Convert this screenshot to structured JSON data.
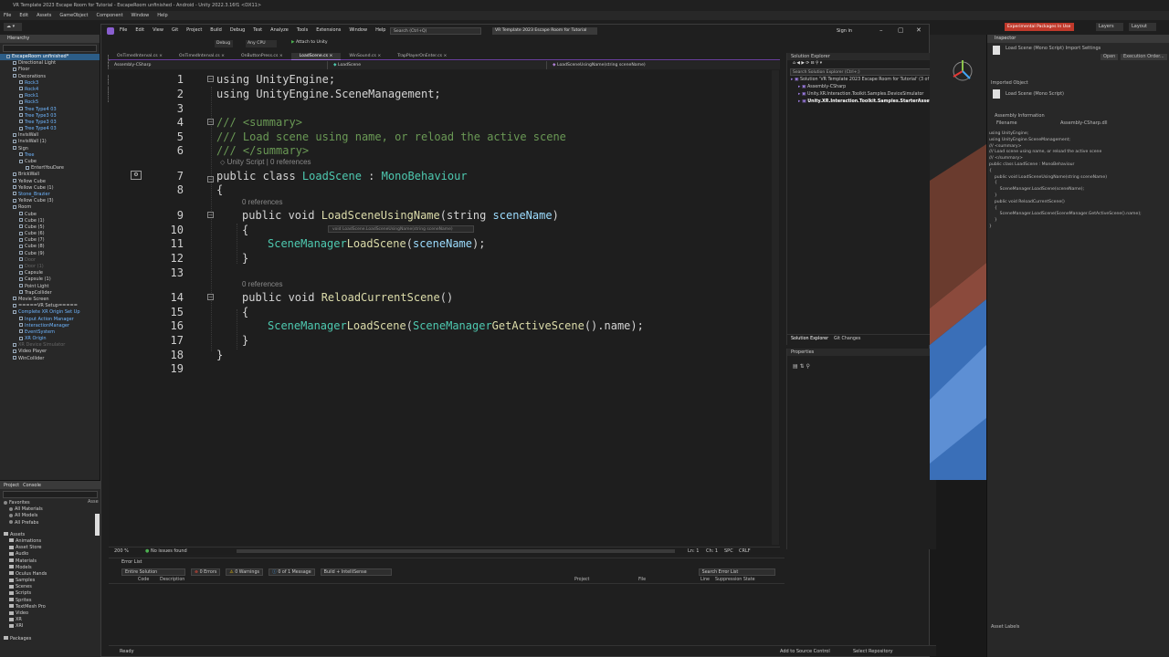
{
  "unity": {
    "window_title": "VR Template 2023 Escape Room for Tutorial - EscapeRoom unfinished - Android - Unity 2022.3.16f1 <DX11>",
    "menu": [
      "File",
      "Edit",
      "Assets",
      "GameObject",
      "Component",
      "Window",
      "Help"
    ],
    "hierarchy": {
      "tab": "Hierarchy",
      "items": [
        {
          "label": "EscapeRoom unfinished*",
          "indent": 1,
          "style": "sel"
        },
        {
          "label": "Directional Light",
          "indent": 2,
          "style": ""
        },
        {
          "label": "Floor",
          "indent": 2,
          "style": ""
        },
        {
          "label": "Decorations",
          "indent": 2,
          "style": ""
        },
        {
          "label": "Rock3",
          "indent": 3,
          "style": "blue"
        },
        {
          "label": "Rock4",
          "indent": 3,
          "style": "blue"
        },
        {
          "label": "Rock1",
          "indent": 3,
          "style": "blue"
        },
        {
          "label": "Rock5",
          "indent": 3,
          "style": "blue"
        },
        {
          "label": "Tree Type4 03",
          "indent": 3,
          "style": "blue"
        },
        {
          "label": "Tree Type3 03",
          "indent": 3,
          "style": "blue"
        },
        {
          "label": "Tree Type3 03",
          "indent": 3,
          "style": "blue"
        },
        {
          "label": "Tree Type4 03",
          "indent": 3,
          "style": "blue"
        },
        {
          "label": "InvisWall",
          "indent": 2,
          "style": ""
        },
        {
          "label": "InvisWall (1)",
          "indent": 2,
          "style": ""
        },
        {
          "label": "Sign",
          "indent": 2,
          "style": ""
        },
        {
          "label": "Tree",
          "indent": 3,
          "style": "blue"
        },
        {
          "label": "Cube",
          "indent": 3,
          "style": ""
        },
        {
          "label": "EntertYouDare",
          "indent": 4,
          "style": ""
        },
        {
          "label": "BrickWall",
          "indent": 2,
          "style": ""
        },
        {
          "label": "Yellow Cube",
          "indent": 2,
          "style": ""
        },
        {
          "label": "Yellow Cube (1)",
          "indent": 2,
          "style": ""
        },
        {
          "label": "Stone_Brazier",
          "indent": 2,
          "style": "blue"
        },
        {
          "label": "Yellow Cube (3)",
          "indent": 2,
          "style": ""
        },
        {
          "label": "Room",
          "indent": 2,
          "style": ""
        },
        {
          "label": "Cube",
          "indent": 3,
          "style": ""
        },
        {
          "label": "Cube (1)",
          "indent": 3,
          "style": ""
        },
        {
          "label": "Cube (5)",
          "indent": 3,
          "style": ""
        },
        {
          "label": "Cube (6)",
          "indent": 3,
          "style": ""
        },
        {
          "label": "Cube (7)",
          "indent": 3,
          "style": ""
        },
        {
          "label": "Cube (8)",
          "indent": 3,
          "style": ""
        },
        {
          "label": "Cube (9)",
          "indent": 3,
          "style": ""
        },
        {
          "label": "Door",
          "indent": 3,
          "style": "dim"
        },
        {
          "label": "Door (1)",
          "indent": 3,
          "style": "dim"
        },
        {
          "label": "Capsule",
          "indent": 3,
          "style": ""
        },
        {
          "label": "Capsule (1)",
          "indent": 3,
          "style": ""
        },
        {
          "label": "Point Light",
          "indent": 3,
          "style": ""
        },
        {
          "label": "TrapCollider",
          "indent": 3,
          "style": ""
        },
        {
          "label": "Movie Screen",
          "indent": 2,
          "style": ""
        },
        {
          "label": "=====VR Setup=====",
          "indent": 2,
          "style": ""
        },
        {
          "label": "Complete XR Origin Set Up",
          "indent": 2,
          "style": "blue"
        },
        {
          "label": "Input Action Manager",
          "indent": 3,
          "style": "blue"
        },
        {
          "label": "InteractionManager",
          "indent": 3,
          "style": "blue"
        },
        {
          "label": "EventSystem",
          "indent": 3,
          "style": "blue"
        },
        {
          "label": "XR Origin",
          "indent": 3,
          "style": "blue"
        },
        {
          "label": "XR Device Simulator",
          "indent": 2,
          "style": "dim"
        },
        {
          "label": "Video Player",
          "indent": 2,
          "style": ""
        },
        {
          "label": "WinCollider",
          "indent": 2,
          "style": ""
        }
      ]
    },
    "project": {
      "tabs": [
        "Project",
        "Console"
      ],
      "favorites_label": "Favorites",
      "favorites": [
        "All Materials",
        "All Models",
        "All Prefabs"
      ],
      "assets_label": "Assets",
      "assets": [
        "Animations",
        "Asset Store",
        "Audio",
        "Materials",
        "Models",
        "Oculus Hands",
        "Samples",
        "Scenes",
        "Scripts",
        "Sprites",
        "TextMesh Pro",
        "Video",
        "XR",
        "XRI"
      ],
      "packages_label": "Packages",
      "side_label": "Asse"
    },
    "inspector": {
      "tab": "Inspector",
      "title": "Load Scene (Mono Script) Import Settings",
      "open_btn": "Open",
      "exec_btn": "Execution Order...",
      "imported_label": "Imported Object",
      "object_name": "Load Scene (Mono Script)",
      "assembly_heading": "Assembly Information",
      "filename_label": "Filename",
      "filename_value": "Assembly-CSharp.dll",
      "preview": [
        "using UnityEngine;",
        "using UnityEngine.SceneManagement;",
        "",
        "/// <summary>",
        "/// Load scene using name, or reload the active scene",
        "/// </summary>",
        "public class LoadScene : MonoBehaviour",
        "{",
        "    public void LoadSceneUsingName(string sceneName)",
        "    {",
        "        SceneManager.LoadScene(sceneName);",
        "    }",
        "",
        "    public void ReloadCurrentScene()",
        "    {",
        "        SceneManager.LoadScene(SceneManager.GetActiveScene().name);",
        "    }",
        "}"
      ],
      "asset_labels": "Asset Labels"
    },
    "top_right": {
      "packages_btn": "Experimental Packages In Use",
      "layers": "Layers",
      "layout": "Layout"
    }
  },
  "vs": {
    "menu": [
      "File",
      "Edit",
      "View",
      "Git",
      "Project",
      "Build",
      "Debug",
      "Test",
      "Analyze",
      "Tools",
      "Extensions",
      "Window",
      "Help"
    ],
    "search": "Search (Ctrl+Q)",
    "solution_name": "VR Template 2023 Escape Room for Tutorial",
    "sign_in": "Sign in",
    "toolbar": {
      "config": "Debug",
      "platform": "Any CPU",
      "attach": "Attach to Unity"
    },
    "tabs": [
      {
        "label": "OnTimedInterval.cs",
        "active": false
      },
      {
        "label": "OnTimedInterval.cs",
        "active": false
      },
      {
        "label": "OnButtonPress.cs",
        "active": false
      },
      {
        "label": "LoadScene.cs",
        "active": true
      },
      {
        "label": "WinSound.cs",
        "active": false
      },
      {
        "label": "TrapPlayerOnEnter.cs",
        "active": false
      }
    ],
    "nav": {
      "project": "Assembly-CSharp",
      "type": "LoadScene",
      "member": "LoadSceneUsingName(string sceneName)"
    },
    "side_tabs": [
      "Toolbox",
      "Data Sources"
    ],
    "code": {
      "lines": [
        "1",
        "2",
        "3",
        "4",
        "5",
        "6",
        "7",
        "8",
        "9",
        "10",
        "11",
        "12",
        "13",
        "14",
        "15",
        "16",
        "17",
        "18",
        "19"
      ],
      "l1_kw": "using",
      "l1_ns": " UnityEngine;",
      "l2_kw": "using",
      "l2_ns": " UnityEngine.SceneManagement;",
      "l4": "/// <summary>",
      "l5": "/// Load scene using name, or reload the active scene",
      "l6": "/// </summary>",
      "lens_class": "Unity Script | 0 references",
      "l7_a": "public class ",
      "l7_b": "LoadScene",
      "l7_c": " : ",
      "l7_d": "MonoBehaviour",
      "l8": "{",
      "lens_m1": "0 references",
      "l9_a": "public void ",
      "l9_b": "LoadSceneUsingName",
      "l9_c": "(string ",
      "l9_d": "sceneName",
      ")": ")",
      "l10": "{",
      "l11_a": "SceneManager",
      ".": ".",
      "l11_b": "LoadScene",
      "l11_c": "(",
      "l11_d": "sceneName",
      "l11_e": ");",
      "l12": "}",
      "lens_m2": "0 references",
      "l14_a": "public void ",
      "l14_b": "ReloadCurrentScene",
      "l14_c": "()",
      "l15": "{",
      "l16_a": "SceneManager",
      "l16_b": "LoadScene",
      "l16_c": "(",
      "l16_d": "SceneManager",
      "l16_e": "GetActiveScene",
      "l16_f": "().name);",
      "l17": "}",
      "l18": "}",
      "tooltip": "void LoadScene.LoadSceneUsingName(string sceneName)"
    },
    "editor_status": {
      "zoom": "200 %",
      "issues": "No issues found",
      "ln": "Ln: 1",
      "ch": "Ch: 1",
      "spc": "SPC",
      "crlf": "CRLF"
    },
    "error_list": {
      "title": "Error List",
      "scope": "Entire Solution",
      "errors": "0 Errors",
      "warnings": "0 Warnings",
      "messages": "0 of 1 Message",
      "build": "Build + IntelliSense",
      "search": "Search Error List",
      "columns": [
        "Code",
        "Description",
        "Project",
        "File",
        "Line",
        "Suppression State"
      ]
    },
    "solution_explorer": {
      "title": "Solution Explorer",
      "search": "Search Solution Explorer (Ctrl+;)",
      "items": [
        {
          "label": "Solution 'VR Template 2023 Escape Room for Tutorial' (3 of",
          "indent": 0,
          "sel": false
        },
        {
          "label": "Assembly-CSharp",
          "indent": 1,
          "sel": false
        },
        {
          "label": "Unity.XR.Interaction.Toolkit.Samples.DeviceSimulator",
          "indent": 1,
          "sel": false
        },
        {
          "label": "Unity.XR.Interaction.Toolkit.Samples.StarterAssets",
          "indent": 1,
          "sel": true
        }
      ],
      "tab1": "Solution Explorer",
      "tab2": "Git Changes"
    },
    "properties_title": "Properties",
    "status": {
      "ready": "Ready",
      "source_control": "Add to Source Control",
      "repo": "Select Repository"
    }
  },
  "colors": {
    "accent": "#6b3fa0",
    "link": "#6fb6ff"
  }
}
